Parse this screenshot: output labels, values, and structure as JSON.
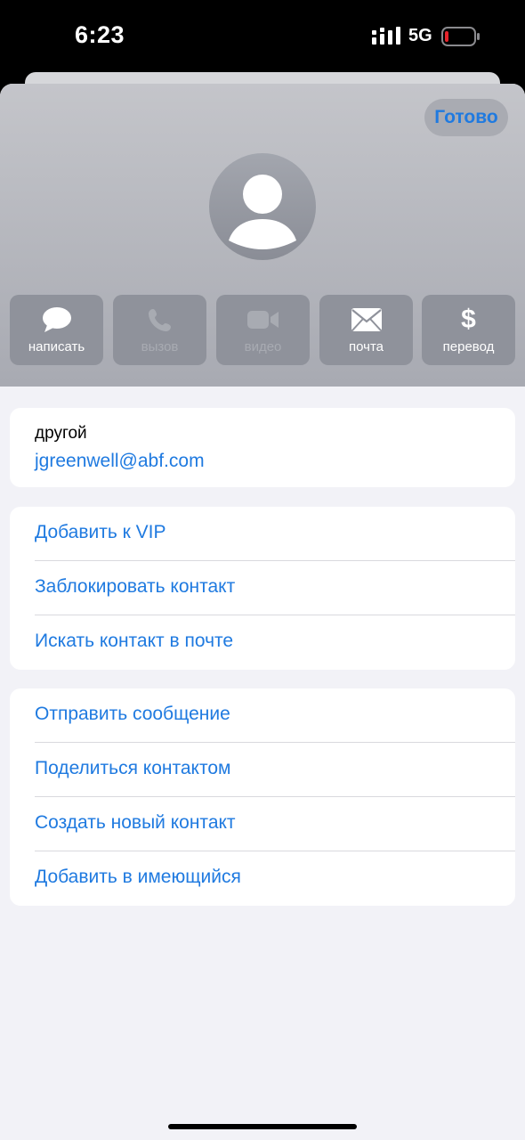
{
  "status_bar": {
    "time": "6:23",
    "network": "5G",
    "icons": [
      "cellular-signal-icon",
      "battery-low-icon"
    ]
  },
  "header": {
    "done_label": "Готово",
    "avatar_icon": "person-silhouette-icon",
    "actions": [
      {
        "label": "написать",
        "icon": "message-bubble-icon",
        "enabled": true
      },
      {
        "label": "вызов",
        "icon": "phone-icon",
        "enabled": false
      },
      {
        "label": "видео",
        "icon": "video-camera-icon",
        "enabled": false
      },
      {
        "label": "почта",
        "icon": "envelope-icon",
        "enabled": true
      },
      {
        "label": "перевод",
        "icon": "dollar-icon",
        "enabled": true
      }
    ]
  },
  "email": {
    "label": "другой",
    "value": "jgreenwell@abf.com"
  },
  "group1": {
    "items": [
      {
        "label": "Добавить к VIP"
      },
      {
        "label": "Заблокировать контакт"
      },
      {
        "label": "Искать контакт в почте"
      }
    ]
  },
  "group2": {
    "items": [
      {
        "label": "Отправить сообщение"
      },
      {
        "label": "Поделиться контактом"
      },
      {
        "label": "Создать новый контакт"
      },
      {
        "label": "Добавить в имеющийся"
      }
    ]
  },
  "colors": {
    "accent": "#1f7ae0",
    "background": "#f2f2f7",
    "header_top": "#c4c5ca",
    "action_button": "#8f929b",
    "battery_low": "#e5242b"
  }
}
